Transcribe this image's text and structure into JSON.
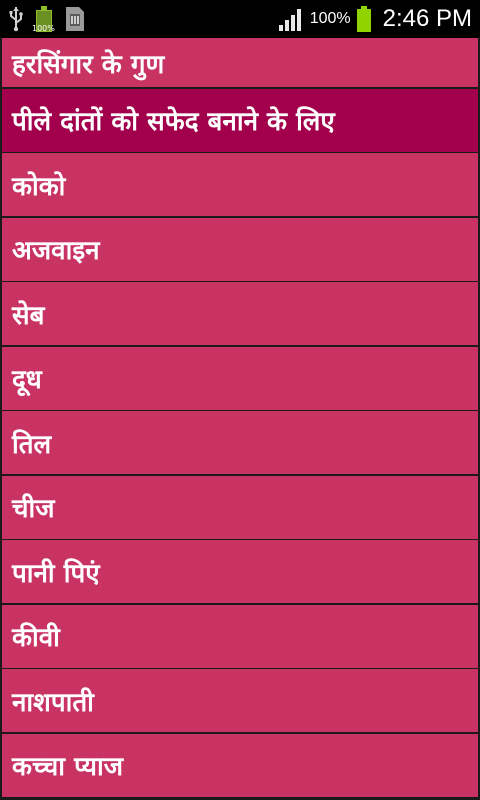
{
  "status_bar": {
    "battery_small_percent": "100%",
    "battery_percent": "100%",
    "time": "2:46 PM"
  },
  "list": {
    "items": [
      "हरसिंगार के गुण",
      "पीले दांतों को सफेद बनाने के लिए",
      "कोको",
      "अजवाइन",
      "सेब",
      "दूध",
      "तिल",
      "चीज",
      "पानी पिएं",
      "कीवी",
      "नाशपाती",
      "कच्चा प्याज"
    ],
    "selected_index": 1
  },
  "colors": {
    "item_bg": "#c83363",
    "item_selected_bg": "#a2004c",
    "divider": "#1a1a1a",
    "status_bar_bg": "#000000"
  }
}
